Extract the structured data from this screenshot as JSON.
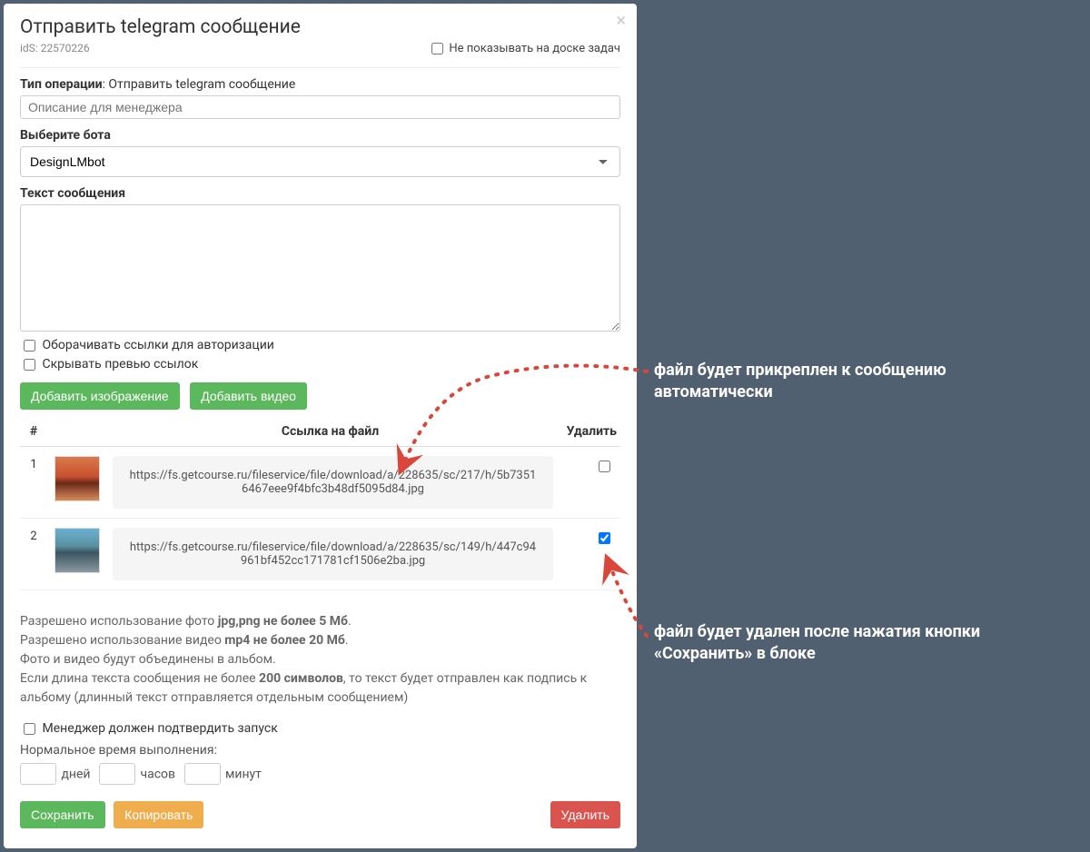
{
  "modal": {
    "title": "Отправить telegram сообщение",
    "id_label": "idS: 22570226",
    "close": "×",
    "hide_board_label": "Не показывать на доске задач"
  },
  "operation": {
    "label": "Тип операции",
    "value": "Отправить telegram сообщение",
    "description_placeholder": "Описание для менеджера"
  },
  "bot": {
    "label": "Выберите бота",
    "selected": "DesignLMbot"
  },
  "message": {
    "label": "Текст сообщения",
    "wrap_links_label": "Оборачивать ссылки для авторизации",
    "hide_preview_label": "Скрывать превью ссылок"
  },
  "buttons": {
    "add_image": "Добавить изображение",
    "add_video": "Добавить видео",
    "save": "Сохранить",
    "copy": "Копировать",
    "delete": "Удалить"
  },
  "table": {
    "col_num": "#",
    "col_url": "Ссылка на файл",
    "col_delete": "Удалить",
    "rows": [
      {
        "n": "1",
        "url": "https://fs.getcourse.ru/fileservice/file/download/a/228635/sc/217/h/5b73516467eee9f4bfc3b48df5095d84.jpg",
        "checked": false
      },
      {
        "n": "2",
        "url": "https://fs.getcourse.ru/fileservice/file/download/a/228635/sc/149/h/447c94961bf452cc171781cf1506e2ba.jpg",
        "checked": true
      }
    ]
  },
  "help": {
    "line1_a": "Разрешено использование фото ",
    "line1_b": "jpg,png не более 5 Мб",
    "line2_a": "Разрешено использование видео ",
    "line2_b": "mp4 не более 20 Мб",
    "line3": "Фото и видео будут объединены в альбом.",
    "line4_a": "Если длина текста сообщения не более ",
    "line4_b": "200 символов",
    "line4_c": ", то текст будет отправлен как подпись к альбому (длинный текст отправляется отдельным сообщением)"
  },
  "confirm": {
    "label": "Менеджер должен подтвердить запуск"
  },
  "exec": {
    "label": "Нормальное время выполнения:",
    "days": "дней",
    "hours": "часов",
    "minutes": "минут"
  },
  "annotations": {
    "a1": "файл будет прикреплен к сообщению автоматически",
    "a2": "файл будет удален после нажатия кнопки «Сохранить» в блоке"
  }
}
